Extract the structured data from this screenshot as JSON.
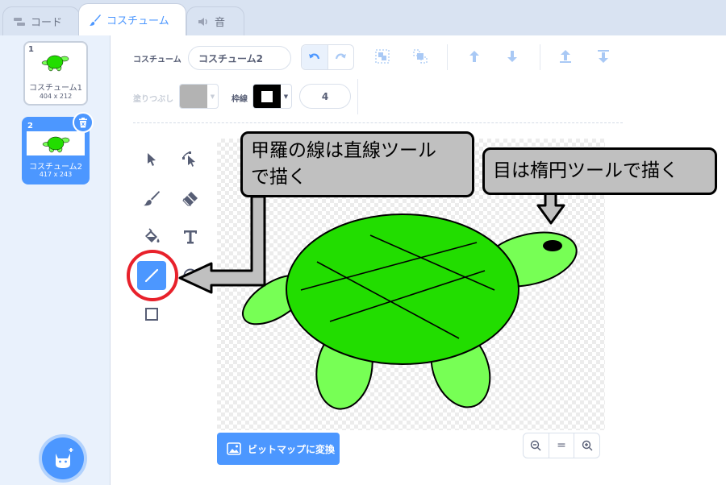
{
  "tabs": [
    {
      "label": "コード",
      "icon": "code-icon"
    },
    {
      "label": "コスチューム",
      "icon": "brush-icon"
    },
    {
      "label": "音",
      "icon": "speaker-icon"
    }
  ],
  "costumes": [
    {
      "num": "1",
      "name": "コスチューム1",
      "size": "404 x 212"
    },
    {
      "num": "2",
      "name": "コスチューム2",
      "size": "417 x 243"
    }
  ],
  "toolbar": {
    "costume_label": "コスチューム",
    "costume_name": "コスチューム2",
    "fill_label": "塗りつぶし",
    "outline_label": "枠線",
    "outline_width": "4"
  },
  "colors": {
    "accent": "#4c97ff",
    "fill_swatch": "#b3b3b3",
    "outline_swatch": "#000000",
    "turtle_shell": "#22dd00",
    "turtle_limbs": "#77ff55",
    "highlight_ring": "#e8212b"
  },
  "canvas_footer": {
    "convert_label": "ビットマップに変換",
    "zoom_reset": "="
  },
  "annotations": {
    "line_tool_note": "甲羅の線は直線ツールで描く",
    "line_tool_note_l1": "甲羅の線は直線ツール",
    "line_tool_note_l2": "で描く",
    "ellipse_tool_note": "目は楕円ツールで描く"
  }
}
